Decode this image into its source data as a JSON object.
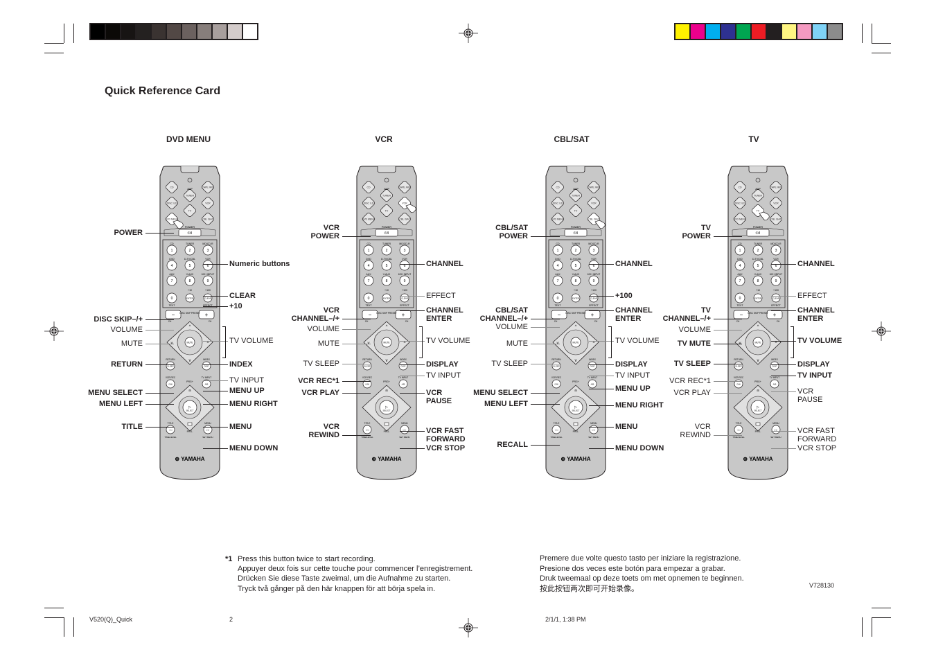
{
  "page": {
    "title": "Quick Reference Card",
    "columns": [
      "DVD MENU",
      "VCR",
      "CBL/SAT",
      "TV"
    ],
    "brand": "YAMAHA",
    "code": "V728130"
  },
  "color_bars": {
    "grayscale": [
      "#000000",
      "#0b0907",
      "#171413",
      "#242120",
      "#3a3331",
      "#524845",
      "#6b615f",
      "#877e7b",
      "#a89f9d",
      "#d4cccb",
      "#ffffff"
    ],
    "process": [
      "#fff200",
      "#ec008c",
      "#00aeef",
      "#2e3192",
      "#00a651",
      "#ed1c24",
      "#231f20",
      "#fff582",
      "#f49ac1",
      "#7fd3f7",
      "#8c8c8c"
    ]
  },
  "remote": {
    "source_buttons": [
      "CD",
      "AMP",
      "TAPE /MD",
      "DISC /LD",
      "TUNER",
      "VCR",
      "TV",
      "DVD MENU",
      "CBL /SAT"
    ],
    "power_label": "POWER",
    "power_button": "⏻/I",
    "numeric_top_labels": [
      "CD",
      "TUNER",
      "MD/CD-R",
      "DVD",
      "D-TV/CBL",
      "VCR",
      "AUX",
      "V-AUX",
      "6CH INPUT"
    ],
    "numbers": [
      "1",
      "2",
      "3",
      "4",
      "5",
      "6",
      "7",
      "8",
      "9",
      "0"
    ],
    "small_labels": [
      "TEXT",
      "+10",
      "+100",
      "ENTER",
      "CLEAR",
      "EFFECT"
    ],
    "disc_skip": "DISC SKIP PRESET",
    "ch_labels": [
      "CH",
      "CH"
    ],
    "vol_center": "MUTE",
    "other_buttons": [
      "RETURN",
      "INDEX",
      "VCR REC",
      "TV INPUT",
      "PRG+",
      "TITLE",
      "MENU",
      "PRG-",
      "TIME/LEVEL",
      "SET MENU"
    ]
  },
  "dvd": {
    "left": [
      {
        "text": "POWER",
        "bold": true
      },
      {
        "text": "DISC SKIP–/+",
        "bold": true
      },
      {
        "text": "VOLUME",
        "bold": false
      },
      {
        "text": "MUTE",
        "bold": false
      },
      {
        "text": "RETURN",
        "bold": true
      },
      {
        "text": "MENU SELECT",
        "bold": true
      },
      {
        "text": "MENU LEFT",
        "bold": true
      },
      {
        "text": "TITLE",
        "bold": true
      }
    ],
    "right": [
      {
        "text": "Numeric buttons",
        "bold": true
      },
      {
        "text": "CLEAR",
        "bold": true
      },
      {
        "text": "+10",
        "bold": true
      },
      {
        "text": "TV VOLUME",
        "bold": false
      },
      {
        "text": "INDEX",
        "bold": true
      },
      {
        "text": "TV INPUT",
        "bold": false
      },
      {
        "text": "MENU UP",
        "bold": true
      },
      {
        "text": "MENU RIGHT",
        "bold": true
      },
      {
        "text": "MENU",
        "bold": true
      },
      {
        "text": "MENU DOWN",
        "bold": true
      }
    ]
  },
  "vcr": {
    "left": [
      {
        "text": "VCR\nPOWER",
        "bold": true
      },
      {
        "text": "VCR\nCHANNEL–/+",
        "bold": true
      },
      {
        "text": "VOLUME",
        "bold": false
      },
      {
        "text": "MUTE",
        "bold": false
      },
      {
        "text": "TV SLEEP",
        "bold": false
      },
      {
        "text": "VCR REC*1",
        "bold": true
      },
      {
        "text": "VCR PLAY",
        "bold": true
      },
      {
        "text": "VCR\nREWIND",
        "bold": true
      }
    ],
    "right": [
      {
        "text": "CHANNEL",
        "bold": true
      },
      {
        "text": "EFFECT",
        "bold": false
      },
      {
        "text": "CHANNEL\nENTER",
        "bold": true
      },
      {
        "text": "TV VOLUME",
        "bold": false
      },
      {
        "text": "DISPLAY",
        "bold": true
      },
      {
        "text": "TV INPUT",
        "bold": false
      },
      {
        "text": "VCR\nPAUSE",
        "bold": true
      },
      {
        "text": "VCR FAST\nFORWARD",
        "bold": true
      },
      {
        "text": "VCR STOP",
        "bold": true
      }
    ]
  },
  "cbl": {
    "left": [
      {
        "text": "CBL/SAT\nPOWER",
        "bold": true
      },
      {
        "text": "CBL/SAT\nCHANNEL–/+",
        "bold": true
      },
      {
        "text": "VOLUME",
        "bold": false
      },
      {
        "text": "MUTE",
        "bold": false
      },
      {
        "text": "TV SLEEP",
        "bold": false
      },
      {
        "text": "MENU SELECT",
        "bold": true
      },
      {
        "text": "MENU LEFT",
        "bold": true
      },
      {
        "text": "RECALL",
        "bold": true
      }
    ],
    "right": [
      {
        "text": "CHANNEL",
        "bold": true
      },
      {
        "text": "+100",
        "bold": true
      },
      {
        "text": "CHANNEL\nENTER",
        "bold": true
      },
      {
        "text": "TV VOLUME",
        "bold": false
      },
      {
        "text": "DISPLAY",
        "bold": true
      },
      {
        "text": "TV INPUT",
        "bold": false
      },
      {
        "text": "MENU UP",
        "bold": true
      },
      {
        "text": "MENU RIGHT",
        "bold": true
      },
      {
        "text": "MENU",
        "bold": true
      },
      {
        "text": "MENU DOWN",
        "bold": true
      }
    ]
  },
  "tv": {
    "left": [
      {
        "text": "TV\nPOWER",
        "bold": true
      },
      {
        "text": "TV\nCHANNEL–/+",
        "bold": true
      },
      {
        "text": "VOLUME",
        "bold": false
      },
      {
        "text": "TV MUTE",
        "bold": true
      },
      {
        "text": "TV SLEEP",
        "bold": true
      },
      {
        "text": "VCR REC*1",
        "bold": false
      },
      {
        "text": "VCR PLAY",
        "bold": false
      },
      {
        "text": "VCR\nREWIND",
        "bold": false
      }
    ],
    "right": [
      {
        "text": "CHANNEL",
        "bold": true
      },
      {
        "text": "EFFECT",
        "bold": false
      },
      {
        "text": "CHANNEL\nENTER",
        "bold": true
      },
      {
        "text": "TV VOLUME",
        "bold": true
      },
      {
        "text": "DISPLAY",
        "bold": true
      },
      {
        "text": "TV INPUT",
        "bold": true
      },
      {
        "text": "VCR\nPAUSE",
        "bold": false
      },
      {
        "text": "VCR FAST\nFORWARD",
        "bold": false
      },
      {
        "text": "VCR STOP",
        "bold": false
      }
    ]
  },
  "footnote": {
    "marker": "*1",
    "lines_left": [
      "Press this button twice to start recording.",
      "Appuyer deux fois sur cette touche pour commencer l’enregistrement.",
      "Drücken Sie diese Taste zweimal, um die Aufnahme zu starten.",
      "Tryck två gånger på den här knappen för att börja spela in."
    ],
    "lines_right": [
      "Premere due volte questo tasto per iniziare la registrazione.",
      "Presione dos veces este botón para empezar a grabar.",
      "Druk tweemaal op deze toets om met opnemen te beginnen.",
      "按此按钮两次即可开始录像。"
    ]
  },
  "footer": {
    "file": "V520(Q)_Quick",
    "page": "2",
    "date": "2/1/1, 1:38 PM"
  }
}
